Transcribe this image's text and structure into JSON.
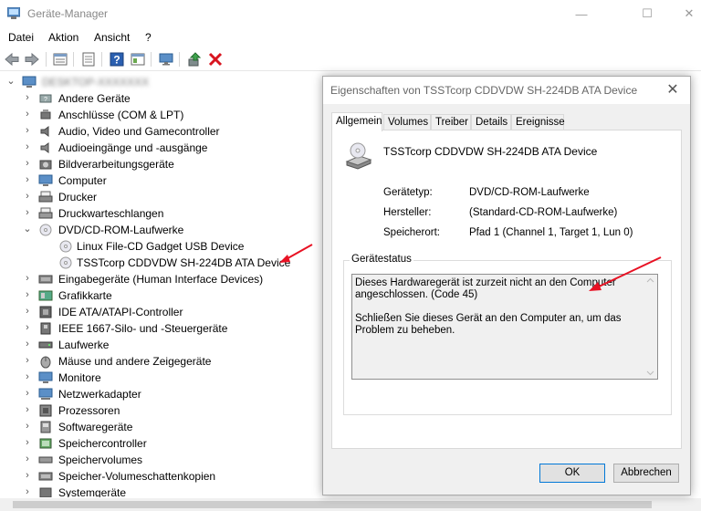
{
  "window": {
    "title": "Geräte-Manager",
    "minimize_glyph": "—",
    "maximize_glyph": "☐",
    "close_glyph": "✕"
  },
  "menu": [
    "Datei",
    "Aktion",
    "Ansicht",
    "?"
  ],
  "toolbar_icons": [
    "back-arrow-icon",
    "forward-arrow-icon",
    "properties-grid-icon",
    "document-icon",
    "help-icon",
    "panel-icon",
    "monitor-icon",
    "update-driver-icon",
    "uninstall-x-icon"
  ],
  "tree": {
    "root": "DESKTOP-XXXXXXX",
    "categories": [
      {
        "label": "Andere Geräte",
        "expanded": false
      },
      {
        "label": "Anschlüsse (COM & LPT)",
        "expanded": false
      },
      {
        "label": "Audio, Video und Gamecontroller",
        "expanded": false
      },
      {
        "label": "Audioeingänge und -ausgänge",
        "expanded": false
      },
      {
        "label": "Bildverarbeitungsgeräte",
        "expanded": false
      },
      {
        "label": "Computer",
        "expanded": false
      },
      {
        "label": "Drucker",
        "expanded": false
      },
      {
        "label": "Druckwarteschlangen",
        "expanded": false
      },
      {
        "label": "DVD/CD-ROM-Laufwerke",
        "expanded": true,
        "children": [
          "Linux File-CD Gadget USB Device",
          "TSSTcorp CDDVDW SH-224DB ATA Device"
        ]
      },
      {
        "label": "Eingabegeräte (Human Interface Devices)",
        "expanded": false
      },
      {
        "label": "Grafikkarte",
        "expanded": false
      },
      {
        "label": "IDE ATA/ATAPI-Controller",
        "expanded": false
      },
      {
        "label": "IEEE 1667-Silo- und -Steuergeräte",
        "expanded": false
      },
      {
        "label": "Laufwerke",
        "expanded": false
      },
      {
        "label": "Mäuse und andere Zeigegeräte",
        "expanded": false
      },
      {
        "label": "Monitore",
        "expanded": false
      },
      {
        "label": "Netzwerkadapter",
        "expanded": false
      },
      {
        "label": "Prozessoren",
        "expanded": false
      },
      {
        "label": "Softwaregeräte",
        "expanded": false
      },
      {
        "label": "Speichercontroller",
        "expanded": false
      },
      {
        "label": "Speichervolumes",
        "expanded": false
      },
      {
        "label": "Speicher-Volumeschattenkopien",
        "expanded": false
      },
      {
        "label": "Systemgeräte",
        "expanded": false
      }
    ]
  },
  "dialog": {
    "title": "Eigenschaften von TSSTcorp CDDVDW SH-224DB ATA Device",
    "close_glyph": "✕",
    "tabs": [
      "Allgemein",
      "Volumes",
      "Treiber",
      "Details",
      "Ereignisse"
    ],
    "active_tab": "Allgemein",
    "device_name": "TSSTcorp CDDVDW SH-224DB ATA Device",
    "props": [
      {
        "label": "Gerätetyp:",
        "value": "DVD/CD-ROM-Laufwerke"
      },
      {
        "label": "Hersteller:",
        "value": "(Standard-CD-ROM-Laufwerke)"
      },
      {
        "label": "Speicherort:",
        "value": "Pfad 1 (Channel 1, Target 1, Lun 0)"
      }
    ],
    "status_legend": "Gerätestatus",
    "status_text_1": "Dieses Hardwaregerät ist zurzeit nicht an den Computer angeschlossen. (Code 45)",
    "status_text_2": "Schließen Sie dieses Gerät an den Computer an, um das Problem zu beheben.",
    "ok_label": "OK",
    "cancel_label": "Abbrechen"
  },
  "colors": {
    "accent": "#0078d7",
    "annotation_arrow": "#e81123"
  }
}
